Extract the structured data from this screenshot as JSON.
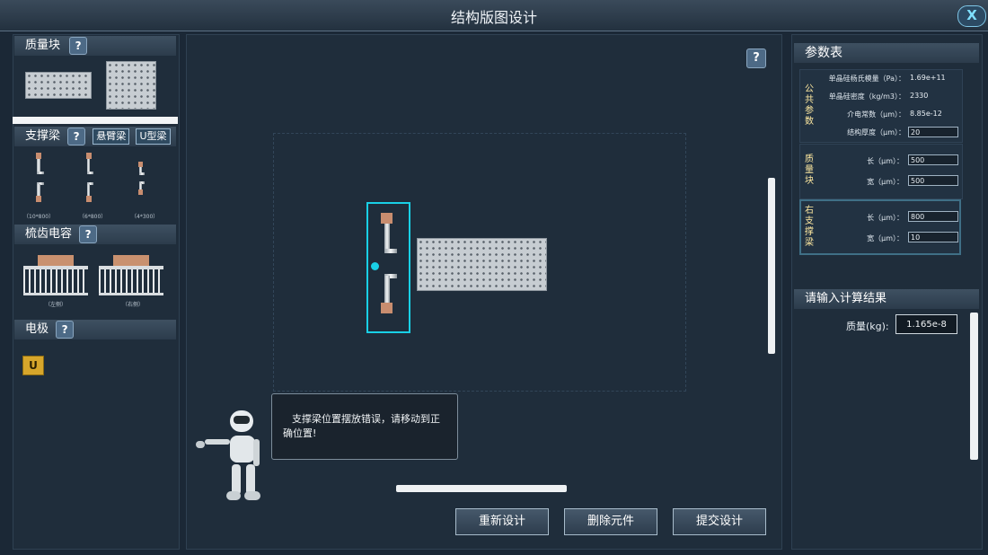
{
  "window": {
    "title": "结构版图设计",
    "close_label": "X"
  },
  "left": {
    "mass": {
      "title": "质量块",
      "help": "?"
    },
    "beam": {
      "title": "支撑梁",
      "help": "?",
      "tab1": "悬臂梁",
      "tab2": "U型梁",
      "items": [
        {
          "label": "（10*800）"
        },
        {
          "label": "（6*800）"
        },
        {
          "label": "（4*300）"
        }
      ]
    },
    "comb": {
      "title": "梳齿电容",
      "help": "?",
      "items": [
        {
          "label": "（左侧）"
        },
        {
          "label": "（右侧）"
        }
      ]
    },
    "electrode": {
      "title": "电极",
      "help": "?",
      "chip_label": "U"
    }
  },
  "canvas": {
    "help": "?"
  },
  "assistant": {
    "message": "支撑梁位置摆放错误，请移动到正确位置!"
  },
  "actions": {
    "reset": "重新设计",
    "delete": "删除元件",
    "submit": "提交设计"
  },
  "params": {
    "title": "参数表",
    "common": {
      "label": "公共参数",
      "rows": [
        {
          "name": "单晶硅杨氏模量（Pa）：",
          "value": "1.69e+11"
        },
        {
          "name": "单晶硅密度（kg/m3）：",
          "value": "2330"
        },
        {
          "name": "介电常数（μm）：",
          "value": "8.85e-12"
        },
        {
          "name": "结构厚度（μm）：",
          "value": "20"
        }
      ]
    },
    "mass": {
      "label": "质量块",
      "length_name": "长（μm）：",
      "length": "500",
      "width_name": "宽（μm）：",
      "width": "500"
    },
    "right_beam": {
      "label": "右支撑梁",
      "length_name": "长（μm）：",
      "length": "800",
      "width_name": "宽（μm）：",
      "width": "10"
    }
  },
  "result": {
    "title": "请输入计算结果",
    "mass_label": "质量(kg):",
    "mass_value": "1.165e-8"
  },
  "colors": {
    "accent": "#19d0e6",
    "background": "#1b2836",
    "panel": "#1f2d3b"
  }
}
